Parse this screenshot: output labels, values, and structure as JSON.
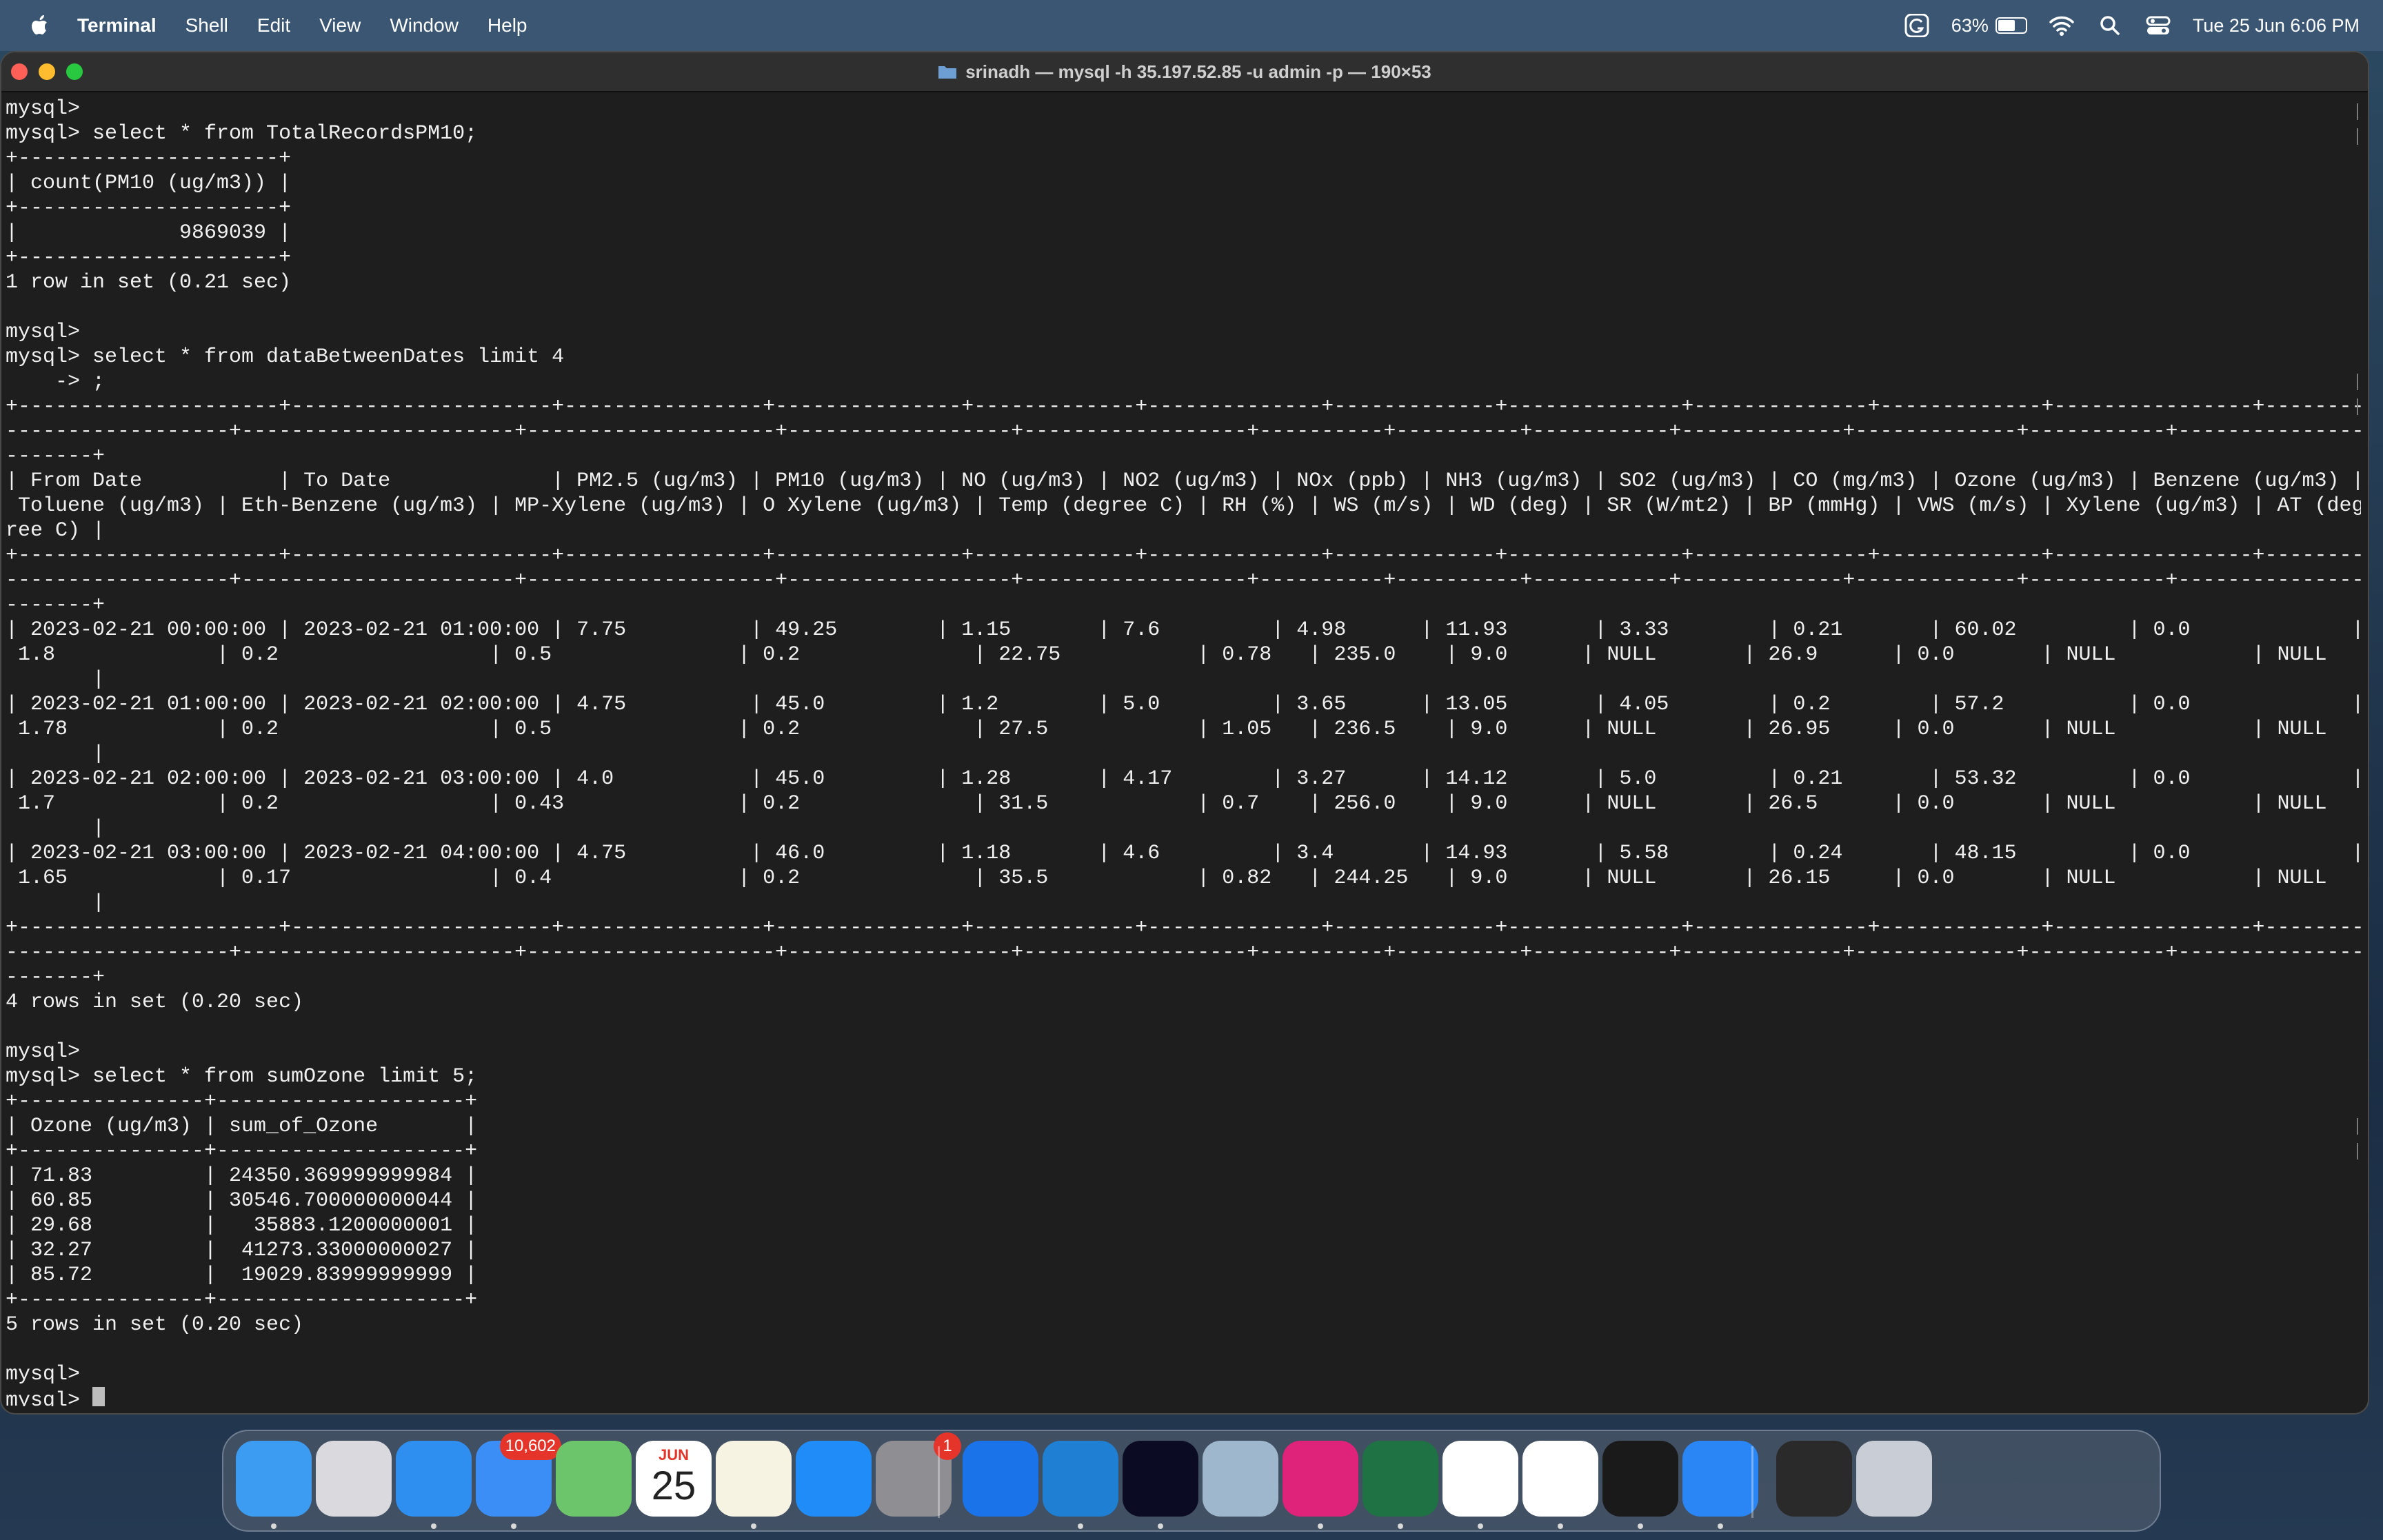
{
  "menubar": {
    "app_name": "Terminal",
    "menus": [
      "Shell",
      "Edit",
      "View",
      "Window",
      "Help"
    ],
    "battery_percent": "63%",
    "battery_level": 0.63,
    "clock": "Tue 25 Jun  6:06 PM"
  },
  "window": {
    "title": "srinadh — mysql -h 35.197.52.85 -u admin -p — 190×53",
    "colors": {
      "close": "#fe5f57",
      "minimize": "#febc2e",
      "zoom": "#28c840"
    }
  },
  "terminal": {
    "lines": [
      "mysql>",
      "mysql> select * from TotalRecordsPM10;",
      "+---------------------+",
      "| count(PM10 (ug/m3)) |",
      "+---------------------+",
      "|             9869039 |",
      "+---------------------+",
      "1 row in set (0.21 sec)",
      "",
      "mysql>",
      "mysql> select * from dataBetweenDates limit 4",
      "    -> ;",
      "+---------------------+---------------------+----------------+---------------+-------------+--------------+-------------+--------------+--------------+-------------+----------------+------------------+",
      "------------------+----------------------+--------------------+------------------+------------------+----------+----------+-----------+-------------+-------------+-----------+----------------+-----------------",
      "-------+",
      "| From Date           | To Date             | PM2.5 (ug/m3) | PM10 (ug/m3) | NO (ug/m3) | NO2 (ug/m3) | NOx (ppb) | NH3 (ug/m3) | SO2 (ug/m3) | CO (mg/m3) | Ozone (ug/m3) | Benzene (ug/m3) |",
      " Toluene (ug/m3) | Eth-Benzene (ug/m3) | MP-Xylene (ug/m3) | O Xylene (ug/m3) | Temp (degree C) | RH (%) | WS (m/s) | WD (deg) | SR (W/mt2) | BP (mmHg) | VWS (m/s) | Xylene (ug/m3) | AT (deg",
      "ree C) |",
      "+---------------------+---------------------+----------------+---------------+-------------+--------------+-------------+--------------+--------------+-------------+----------------+------------------+",
      "------------------+----------------------+--------------------+------------------+------------------+----------+----------+-----------+-------------+-------------+-----------+----------------+-----------------",
      "-------+",
      "| 2023-02-21 00:00:00 | 2023-02-21 01:00:00 | 7.75          | 49.25        | 1.15       | 7.6         | 4.98      | 11.93       | 3.33        | 0.21       | 60.02         | 0.0             |",
      " 1.8             | 0.2                 | 0.5               | 0.2              | 22.75           | 0.78   | 235.0    | 9.0      | NULL       | 26.9      | 0.0       | NULL           | NULL",
      "       |",
      "| 2023-02-21 01:00:00 | 2023-02-21 02:00:00 | 4.75          | 45.0         | 1.2        | 5.0         | 3.65      | 13.05       | 4.05        | 0.2        | 57.2          | 0.0             |",
      " 1.78            | 0.2                 | 0.5               | 0.2              | 27.5            | 1.05   | 236.5    | 9.0      | NULL       | 26.95     | 0.0       | NULL           | NULL",
      "       |",
      "| 2023-02-21 02:00:00 | 2023-02-21 03:00:00 | 4.0           | 45.0         | 1.28       | 4.17        | 3.27      | 14.12       | 5.0         | 0.21       | 53.32         | 0.0             |",
      " 1.7             | 0.2                 | 0.43              | 0.2              | 31.5            | 0.7    | 256.0    | 9.0      | NULL       | 26.5      | 0.0       | NULL           | NULL",
      "       |",
      "| 2023-02-21 03:00:00 | 2023-02-21 04:00:00 | 4.75          | 46.0         | 1.18       | 4.6         | 3.4       | 14.93       | 5.58        | 0.24       | 48.15         | 0.0             |",
      " 1.65            | 0.17                | 0.4               | 0.2              | 35.5            | 0.82   | 244.25   | 9.0      | NULL       | 26.15     | 0.0       | NULL           | NULL",
      "       |",
      "+---------------------+---------------------+----------------+---------------+-------------+--------------+-------------+--------------+--------------+-------------+----------------+------------------+",
      "------------------+----------------------+--------------------+------------------+------------------+----------+----------+-----------+-------------+-------------+-----------+----------------+-----------------",
      "-------+",
      "4 rows in set (0.20 sec)",
      "",
      "mysql>",
      "mysql> select * from sumOzone limit 5;",
      "+---------------+--------------------+",
      "| Ozone (ug/m3) | sum_of_Ozone       |",
      "+---------------+--------------------+",
      "| 71.83         | 24350.369999999984 |",
      "| 60.85         | 30546.700000000044 |",
      "| 29.68         |   35883.1200000001 |",
      "| 32.27         |  41273.33000000027 |",
      "| 85.72         |  19029.83999999999 |",
      "+---------------+--------------------+",
      "5 rows in set (0.20 sec)",
      "",
      "mysql>"
    ],
    "prompt": "mysql> "
  },
  "dock": {
    "items": [
      {
        "name": "Finder",
        "icon": "finder-icon",
        "color": "#3c9cf2"
      },
      {
        "name": "Launchpad",
        "icon": "launchpad-icon",
        "color": "#d9d9de"
      },
      {
        "name": "Safari",
        "icon": "safari-icon",
        "color": "#2f8ff0"
      },
      {
        "name": "Mail",
        "icon": "mail-icon",
        "color": "#3a8ef5",
        "badge": "10,602"
      },
      {
        "name": "Maps",
        "icon": "maps-icon",
        "color": "#6cc46b"
      },
      {
        "name": "Calendar",
        "icon": "calendar-icon",
        "color": "#ffffff",
        "month": "JUN",
        "day": "25"
      },
      {
        "name": "Notes",
        "icon": "notes-icon",
        "color": "#f7f3e3"
      },
      {
        "name": "App Store",
        "icon": "app-store-icon",
        "color": "#1f8cf7"
      },
      {
        "name": "System Settings",
        "icon": "settings-icon",
        "color": "#8e8e93",
        "badge": "1"
      },
      {
        "name": "Grammarly",
        "icon": "grammarly-icon",
        "color": "#1a73e8"
      },
      {
        "name": "Visual Studio Code",
        "icon": "vscode-icon",
        "color": "#1f7fd2"
      },
      {
        "name": "WebStorm",
        "icon": "webstorm-icon",
        "color": "#0b0b24"
      },
      {
        "name": "Preview",
        "icon": "preview-icon",
        "color": "#9fb7cc"
      },
      {
        "name": "IntelliJ IDEA",
        "icon": "intellij-icon",
        "color": "#e0237a"
      },
      {
        "name": "Excel",
        "icon": "excel-icon",
        "color": "#1f7244"
      },
      {
        "name": "Slack",
        "icon": "slack-icon",
        "color": "#ffffff"
      },
      {
        "name": "Chrome",
        "icon": "chrome-icon",
        "color": "#ffffff"
      },
      {
        "name": "Terminal",
        "icon": "terminal-icon",
        "color": "#1a1a1a"
      },
      {
        "name": "Apple Support",
        "icon": "apple-support-icon",
        "color": "#2b86f5"
      },
      {
        "name": "Terminal window",
        "icon": "minimized-window-icon",
        "color": "#2a2a2a"
      },
      {
        "name": "Trash",
        "icon": "trash-icon",
        "color": "#c9ced6"
      }
    ]
  }
}
